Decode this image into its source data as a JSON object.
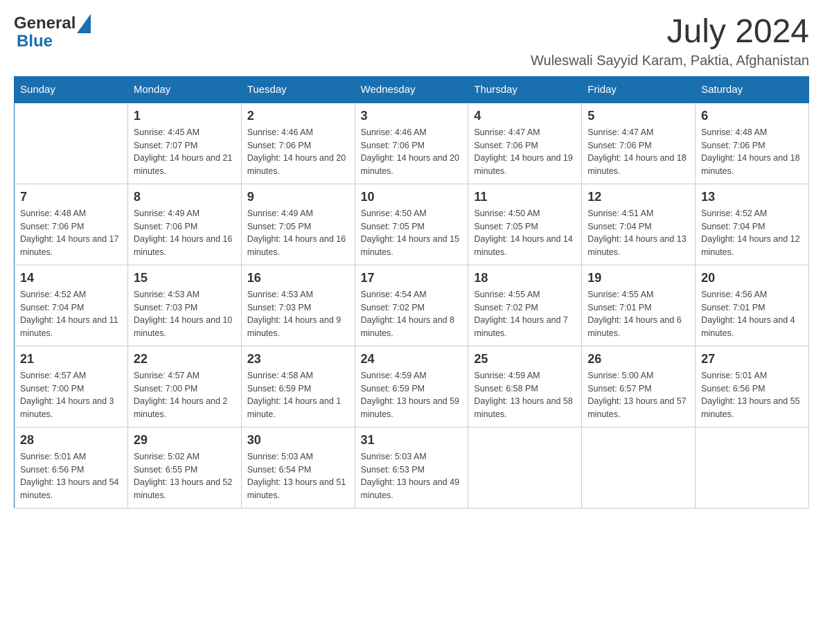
{
  "header": {
    "logo_general": "General",
    "logo_blue": "Blue",
    "month_year": "July 2024",
    "location": "Wuleswali Sayyid Karam, Paktia, Afghanistan"
  },
  "days_of_week": [
    "Sunday",
    "Monday",
    "Tuesday",
    "Wednesday",
    "Thursday",
    "Friday",
    "Saturday"
  ],
  "weeks": [
    {
      "days": [
        {
          "number": "",
          "sunrise": "",
          "sunset": "",
          "daylight": ""
        },
        {
          "number": "1",
          "sunrise": "Sunrise: 4:45 AM",
          "sunset": "Sunset: 7:07 PM",
          "daylight": "Daylight: 14 hours and 21 minutes."
        },
        {
          "number": "2",
          "sunrise": "Sunrise: 4:46 AM",
          "sunset": "Sunset: 7:06 PM",
          "daylight": "Daylight: 14 hours and 20 minutes."
        },
        {
          "number": "3",
          "sunrise": "Sunrise: 4:46 AM",
          "sunset": "Sunset: 7:06 PM",
          "daylight": "Daylight: 14 hours and 20 minutes."
        },
        {
          "number": "4",
          "sunrise": "Sunrise: 4:47 AM",
          "sunset": "Sunset: 7:06 PM",
          "daylight": "Daylight: 14 hours and 19 minutes."
        },
        {
          "number": "5",
          "sunrise": "Sunrise: 4:47 AM",
          "sunset": "Sunset: 7:06 PM",
          "daylight": "Daylight: 14 hours and 18 minutes."
        },
        {
          "number": "6",
          "sunrise": "Sunrise: 4:48 AM",
          "sunset": "Sunset: 7:06 PM",
          "daylight": "Daylight: 14 hours and 18 minutes."
        }
      ]
    },
    {
      "days": [
        {
          "number": "7",
          "sunrise": "Sunrise: 4:48 AM",
          "sunset": "Sunset: 7:06 PM",
          "daylight": "Daylight: 14 hours and 17 minutes."
        },
        {
          "number": "8",
          "sunrise": "Sunrise: 4:49 AM",
          "sunset": "Sunset: 7:06 PM",
          "daylight": "Daylight: 14 hours and 16 minutes."
        },
        {
          "number": "9",
          "sunrise": "Sunrise: 4:49 AM",
          "sunset": "Sunset: 7:05 PM",
          "daylight": "Daylight: 14 hours and 16 minutes."
        },
        {
          "number": "10",
          "sunrise": "Sunrise: 4:50 AM",
          "sunset": "Sunset: 7:05 PM",
          "daylight": "Daylight: 14 hours and 15 minutes."
        },
        {
          "number": "11",
          "sunrise": "Sunrise: 4:50 AM",
          "sunset": "Sunset: 7:05 PM",
          "daylight": "Daylight: 14 hours and 14 minutes."
        },
        {
          "number": "12",
          "sunrise": "Sunrise: 4:51 AM",
          "sunset": "Sunset: 7:04 PM",
          "daylight": "Daylight: 14 hours and 13 minutes."
        },
        {
          "number": "13",
          "sunrise": "Sunrise: 4:52 AM",
          "sunset": "Sunset: 7:04 PM",
          "daylight": "Daylight: 14 hours and 12 minutes."
        }
      ]
    },
    {
      "days": [
        {
          "number": "14",
          "sunrise": "Sunrise: 4:52 AM",
          "sunset": "Sunset: 7:04 PM",
          "daylight": "Daylight: 14 hours and 11 minutes."
        },
        {
          "number": "15",
          "sunrise": "Sunrise: 4:53 AM",
          "sunset": "Sunset: 7:03 PM",
          "daylight": "Daylight: 14 hours and 10 minutes."
        },
        {
          "number": "16",
          "sunrise": "Sunrise: 4:53 AM",
          "sunset": "Sunset: 7:03 PM",
          "daylight": "Daylight: 14 hours and 9 minutes."
        },
        {
          "number": "17",
          "sunrise": "Sunrise: 4:54 AM",
          "sunset": "Sunset: 7:02 PM",
          "daylight": "Daylight: 14 hours and 8 minutes."
        },
        {
          "number": "18",
          "sunrise": "Sunrise: 4:55 AM",
          "sunset": "Sunset: 7:02 PM",
          "daylight": "Daylight: 14 hours and 7 minutes."
        },
        {
          "number": "19",
          "sunrise": "Sunrise: 4:55 AM",
          "sunset": "Sunset: 7:01 PM",
          "daylight": "Daylight: 14 hours and 6 minutes."
        },
        {
          "number": "20",
          "sunrise": "Sunrise: 4:56 AM",
          "sunset": "Sunset: 7:01 PM",
          "daylight": "Daylight: 14 hours and 4 minutes."
        }
      ]
    },
    {
      "days": [
        {
          "number": "21",
          "sunrise": "Sunrise: 4:57 AM",
          "sunset": "Sunset: 7:00 PM",
          "daylight": "Daylight: 14 hours and 3 minutes."
        },
        {
          "number": "22",
          "sunrise": "Sunrise: 4:57 AM",
          "sunset": "Sunset: 7:00 PM",
          "daylight": "Daylight: 14 hours and 2 minutes."
        },
        {
          "number": "23",
          "sunrise": "Sunrise: 4:58 AM",
          "sunset": "Sunset: 6:59 PM",
          "daylight": "Daylight: 14 hours and 1 minute."
        },
        {
          "number": "24",
          "sunrise": "Sunrise: 4:59 AM",
          "sunset": "Sunset: 6:59 PM",
          "daylight": "Daylight: 13 hours and 59 minutes."
        },
        {
          "number": "25",
          "sunrise": "Sunrise: 4:59 AM",
          "sunset": "Sunset: 6:58 PM",
          "daylight": "Daylight: 13 hours and 58 minutes."
        },
        {
          "number": "26",
          "sunrise": "Sunrise: 5:00 AM",
          "sunset": "Sunset: 6:57 PM",
          "daylight": "Daylight: 13 hours and 57 minutes."
        },
        {
          "number": "27",
          "sunrise": "Sunrise: 5:01 AM",
          "sunset": "Sunset: 6:56 PM",
          "daylight": "Daylight: 13 hours and 55 minutes."
        }
      ]
    },
    {
      "days": [
        {
          "number": "28",
          "sunrise": "Sunrise: 5:01 AM",
          "sunset": "Sunset: 6:56 PM",
          "daylight": "Daylight: 13 hours and 54 minutes."
        },
        {
          "number": "29",
          "sunrise": "Sunrise: 5:02 AM",
          "sunset": "Sunset: 6:55 PM",
          "daylight": "Daylight: 13 hours and 52 minutes."
        },
        {
          "number": "30",
          "sunrise": "Sunrise: 5:03 AM",
          "sunset": "Sunset: 6:54 PM",
          "daylight": "Daylight: 13 hours and 51 minutes."
        },
        {
          "number": "31",
          "sunrise": "Sunrise: 5:03 AM",
          "sunset": "Sunset: 6:53 PM",
          "daylight": "Daylight: 13 hours and 49 minutes."
        },
        {
          "number": "",
          "sunrise": "",
          "sunset": "",
          "daylight": ""
        },
        {
          "number": "",
          "sunrise": "",
          "sunset": "",
          "daylight": ""
        },
        {
          "number": "",
          "sunrise": "",
          "sunset": "",
          "daylight": ""
        }
      ]
    }
  ]
}
